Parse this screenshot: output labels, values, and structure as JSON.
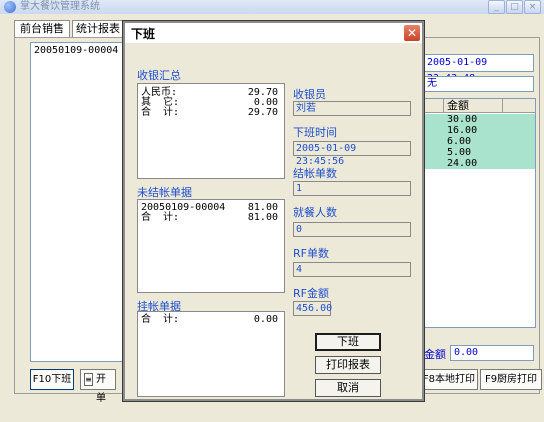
{
  "window": {
    "title": "掌大餐饮管理系统"
  },
  "tabs": [
    {
      "label": "前台销售"
    },
    {
      "label": "统计报表"
    }
  ],
  "left_list": {
    "items": [
      "20050109-00004"
    ]
  },
  "left_buttons": {
    "close_shift": "F10下班",
    "open_shift": "开单"
  },
  "right_panel": {
    "time": "2005-01-09 23:43:48",
    "status": "无",
    "grid_header": "金额",
    "grid_rows": [
      "30.00",
      "16.00",
      "6.00",
      "5.00",
      "24.00"
    ],
    "amount_label": "金额",
    "amount_value": "0.00",
    "local_print": "F8本地打印",
    "kitchen_print": "F9厨房打印"
  },
  "dialog": {
    "title": "下班",
    "summary": {
      "label": "收银汇总",
      "rows": [
        {
          "name": "人民币:",
          "value": "29.70"
        },
        {
          "name": "其  它:",
          "value": "0.00"
        },
        {
          "name": "合  计:",
          "value": "29.70"
        }
      ]
    },
    "unsettled": {
      "label": "未结帐单据",
      "rows": [
        {
          "name": "20050109-00004",
          "value": "81.00"
        },
        {
          "name": "合  计:",
          "value": "81.00"
        }
      ]
    },
    "hold": {
      "label": "挂帐单据",
      "rows": [
        {
          "name": "合  计:",
          "value": "0.00"
        }
      ]
    },
    "fields": {
      "cashier_label": "收银员",
      "cashier": "刘若",
      "offtime_label": "下班时间",
      "offtime": "2005-01-09 23:45:56",
      "billcount_label": "结帐单数",
      "billcount": "1",
      "diners_label": "就餐人数",
      "diners": "0",
      "rfcount_label": "RF单数",
      "rfcount": "4",
      "rfamount_label": "RF金额",
      "rfamount": "456.00"
    },
    "buttons": {
      "close_shift": "下班",
      "print_report": "打印报表",
      "cancel": "取消"
    }
  },
  "colors": {
    "accent": "#1e4fd0",
    "grid_row": "#a9e2cd",
    "close_red": "#c9442a"
  }
}
